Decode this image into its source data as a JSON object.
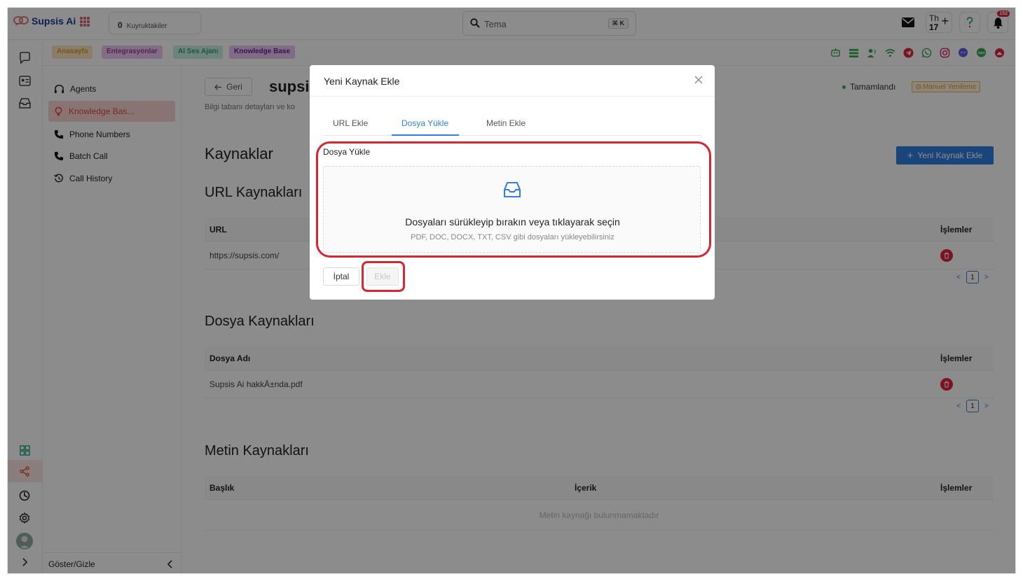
{
  "app": {
    "logo_text": "Supsis Ai",
    "queue_count": "0",
    "queue_label": "Kuyruktakiler",
    "search_value": "Tema",
    "search_shortcut": "⌘ K",
    "th_label": "Th",
    "th_number": "17",
    "notification_count": "152"
  },
  "subbar": {
    "pills": [
      {
        "label": "Anasayfa",
        "bg": "#fbe6c3",
        "color": "#e0962a"
      },
      {
        "label": "Entegrasyonlar",
        "bg": "#ecc8ee",
        "color": "#a23aa8"
      },
      {
        "label": "AI Ses Ajanı",
        "bg": "#cbeee4",
        "color": "#2f9f80"
      },
      {
        "label": "Knowledge Base",
        "bg": "#e5c6f2",
        "color": "#6b2596"
      }
    ]
  },
  "sidebar": {
    "items": [
      {
        "label": "Agents"
      },
      {
        "label": "Knowledge Bas..."
      },
      {
        "label": "Phone Numbers"
      },
      {
        "label": "Batch Call"
      },
      {
        "label": "Call History"
      }
    ],
    "footer_label": "Göster/Gizle"
  },
  "main": {
    "back_label": "Geri",
    "title": "supsis",
    "subtitle": "Bilgi tabanı detayları ve ko",
    "status_label": "Tamamlandı",
    "manual_refresh_label": "Manuel Yenileme",
    "new_source_label": "Yeni Kaynak Ekle",
    "sources_heading": "Kaynaklar",
    "url_section": {
      "heading": "URL Kaynakları",
      "col_url": "URL",
      "col_actions": "İşlemler",
      "rows": [
        {
          "url": "https://supsis.com/"
        }
      ],
      "page": "1"
    },
    "file_section": {
      "heading": "Dosya Kaynakları",
      "col_name": "Dosya Adı",
      "col_actions": "İşlemler",
      "rows": [
        {
          "name": "Supsis Ai hakkÄ±nda.pdf"
        }
      ],
      "page": "1"
    },
    "text_section": {
      "heading": "Metin Kaynakları",
      "col_title": "Başlık",
      "col_content": "İçerik",
      "col_actions": "İşlemler",
      "empty": "Metin kaynağı bulunmamaktadır"
    }
  },
  "modal": {
    "title": "Yeni Kaynak Ekle",
    "tabs": [
      {
        "label": "URL Ekle",
        "active": false
      },
      {
        "label": "Dosya Yükle",
        "active": true
      },
      {
        "label": "Metin Ekle",
        "active": false
      }
    ],
    "field_label": "Dosya Yükle",
    "dropzone_text": "Dosyaları sürükleyip bırakın veya tıklayarak seçin",
    "dropzone_hint": "PDF, DOC, DOCX, TXT, CSV gibi dosyaları yükleyebilirsiniz",
    "cancel_label": "İptal",
    "add_label": "Ekle"
  },
  "colors": {
    "accent": "#2f7fe0",
    "danger": "#e0253c",
    "annotation": "#d62631",
    "active_nav": "#e24b3c"
  }
}
